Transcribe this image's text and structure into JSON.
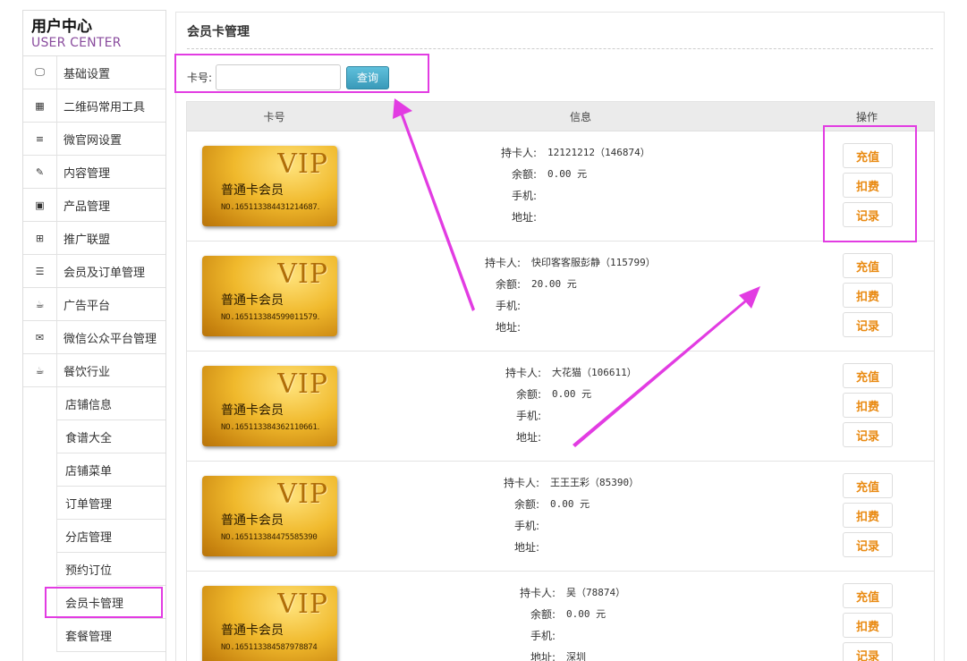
{
  "brand": {
    "title": "用户中心",
    "subtitle": "USER CENTER"
  },
  "sidebar": {
    "items": [
      {
        "icon": "monitor-icon",
        "glyph": "🖵",
        "label": "基础设置"
      },
      {
        "icon": "qrcode-icon",
        "glyph": "▦",
        "label": "二维码常用工具"
      },
      {
        "icon": "list-icon",
        "glyph": "≡",
        "label": "微官网设置"
      },
      {
        "icon": "edit-icon",
        "glyph": "✎",
        "label": "内容管理"
      },
      {
        "icon": "picture-icon",
        "glyph": "▣",
        "label": "产品管理"
      },
      {
        "icon": "gift-icon",
        "glyph": "⊞",
        "label": "推广联盟"
      },
      {
        "icon": "database-icon",
        "glyph": "☰",
        "label": "会员及订单管理"
      },
      {
        "icon": "coffee-icon",
        "glyph": "☕",
        "label": "广告平台"
      },
      {
        "icon": "comments-icon",
        "glyph": "✉",
        "label": "微信公众平台管理"
      },
      {
        "icon": "coffee-icon",
        "glyph": "☕",
        "label": "餐饮行业"
      }
    ],
    "subitems": [
      "店铺信息",
      "食谱大全",
      "店铺菜单",
      "订单管理",
      "分店管理",
      "预约订位",
      "会员卡管理",
      "套餐管理"
    ]
  },
  "page": {
    "title": "会员卡管理"
  },
  "search": {
    "label": "卡号:",
    "button": "查询",
    "value": ""
  },
  "table": {
    "headers": {
      "card": "卡号",
      "info": "信息",
      "ops": "操作"
    },
    "field_labels": {
      "holder": "持卡人:",
      "balance": "余额:",
      "phone": "手机:",
      "address": "地址:"
    },
    "op_labels": {
      "recharge": "充值",
      "deduct": "扣费",
      "record": "记录"
    },
    "rows": [
      {
        "vip": "VIP",
        "type": "普通卡会员",
        "no": "NO.165113384431214687․",
        "holder": "12121212（146874）",
        "balance": "0.00 元",
        "phone": "",
        "address": ""
      },
      {
        "vip": "VIP",
        "type": "普通卡会员",
        "no": "NO.165113384599011579․",
        "holder": "快印客客服彭静（115799）",
        "balance": "20.00 元",
        "phone": "",
        "address": ""
      },
      {
        "vip": "VIP",
        "type": "普通卡会员",
        "no": "NO.165113384362110661․",
        "holder": "大花猫（106611）",
        "balance": "0.00 元",
        "phone": "",
        "address": ""
      },
      {
        "vip": "VIP",
        "type": "普通卡会员",
        "no": "NO.165113384475585390",
        "holder": "王王王彩（85390）",
        "balance": "0.00 元",
        "phone": "",
        "address": ""
      },
      {
        "vip": "VIP",
        "type": "普通卡会员",
        "no": "NO.165113384587978874",
        "holder": "吴（78874）",
        "balance": "0.00 元",
        "phone": "",
        "address": "深圳"
      }
    ]
  },
  "colors": {
    "highlight": "#e23ce2",
    "action_text": "#e98a12",
    "search_button": "#3a9ab9"
  }
}
